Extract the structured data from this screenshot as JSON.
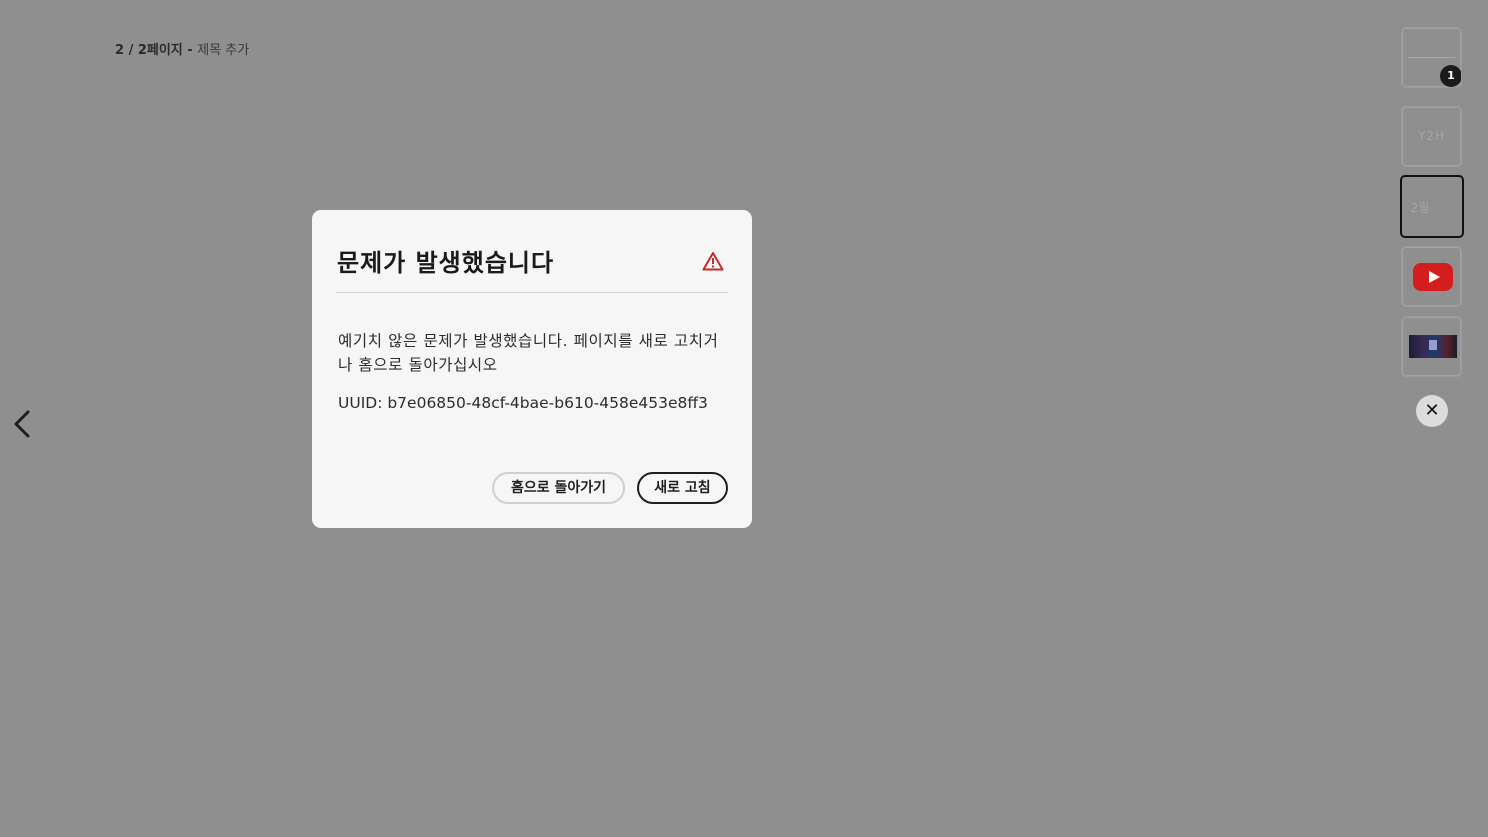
{
  "page_indicator": {
    "count": "2 / 2페이지",
    "separator": " - ",
    "title": "제목 추가"
  },
  "thumbnails": [
    {
      "badge": "1",
      "label": ""
    },
    {
      "label": "Y2H"
    },
    {
      "label": "2월"
    },
    {
      "icon": "youtube-icon"
    },
    {
      "image": "video-thumbnail"
    }
  ],
  "dialog": {
    "title": "문제가 발생했습니다",
    "icon": "warning-icon",
    "message": "예기치 않은 문제가 발생했습니다. 페이지를 새로 고치거나 홈으로 돌아가십시오",
    "uuid": "UUID: b7e06850-48cf-4bae-b610-458e453e8ff3",
    "home_button": "홈으로 돌아가기",
    "refresh_button": "새로 고침"
  },
  "controls": {
    "close_glyph": "✕",
    "prev_icon": "chevron-left-icon"
  },
  "colors": {
    "backdrop": "#8f8f8f",
    "dialog_bg": "#f6f6f6",
    "warning": "#c42b2b",
    "youtube_red": "#d41e1e"
  }
}
